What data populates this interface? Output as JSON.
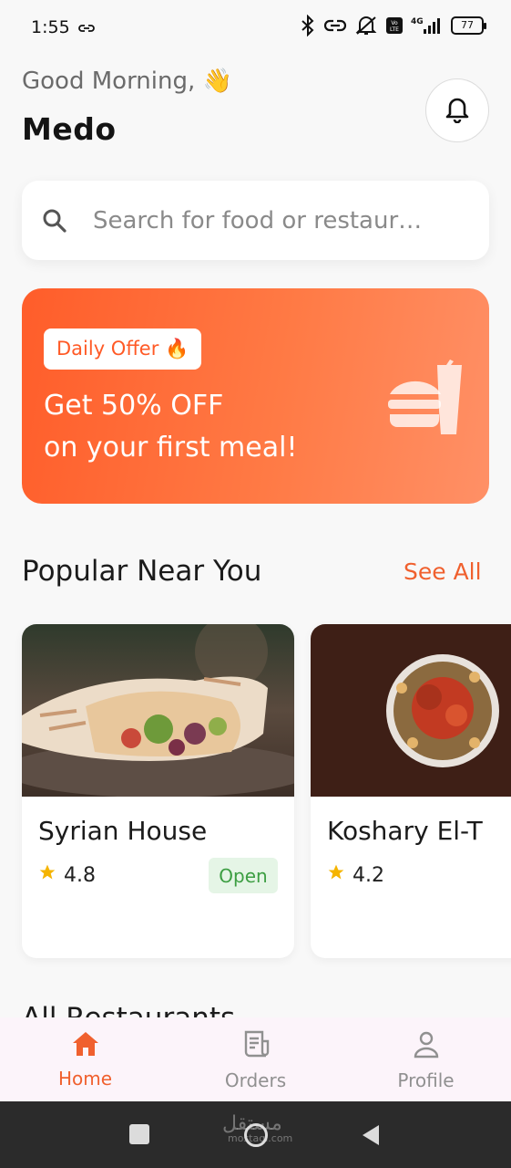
{
  "status_bar": {
    "time": "1:55",
    "battery": "77",
    "icons": [
      "link-icon",
      "bluetooth-icon",
      "link-icon",
      "mute-icon",
      "volte-icon",
      "signal-4g-icon",
      "battery-icon"
    ]
  },
  "header": {
    "greeting": "Good Morning, 👋",
    "user_name": "Medo",
    "notification_icon": "bell-icon"
  },
  "search": {
    "placeholder": "Search for food or restaur…"
  },
  "promo": {
    "badge": "Daily Offer 🔥",
    "title_line1": "Get 50% OFF",
    "title_line2": "on your first meal!",
    "icon": "burger-drink-icon",
    "gradient_start": "#ff5d2a",
    "gradient_end": "#ff9066"
  },
  "popular": {
    "title": "Popular Near You",
    "see_all": "See All",
    "restaurants": [
      {
        "name": "Syrian House",
        "rating": "4.8",
        "status": "Open",
        "image": "shawarma-wrap-photo"
      },
      {
        "name": "Koshary El-T",
        "rating": "4.2",
        "status": "",
        "image": "koshary-bowl-photo"
      }
    ]
  },
  "all_restaurants": {
    "title": "All Restaurants"
  },
  "bottom_nav": {
    "items": [
      {
        "label": "Home",
        "icon": "home-icon",
        "active": true
      },
      {
        "label": "Orders",
        "icon": "receipt-icon",
        "active": false
      },
      {
        "label": "Profile",
        "icon": "person-icon",
        "active": false
      }
    ]
  },
  "system_nav": {
    "watermark": "مستقل",
    "watermark_sub": "mostaql.com"
  },
  "colors": {
    "accent": "#f0602e",
    "open_badge_bg": "#e5f5e6",
    "open_badge_text": "#3c9e42",
    "star": "#f5b400"
  }
}
